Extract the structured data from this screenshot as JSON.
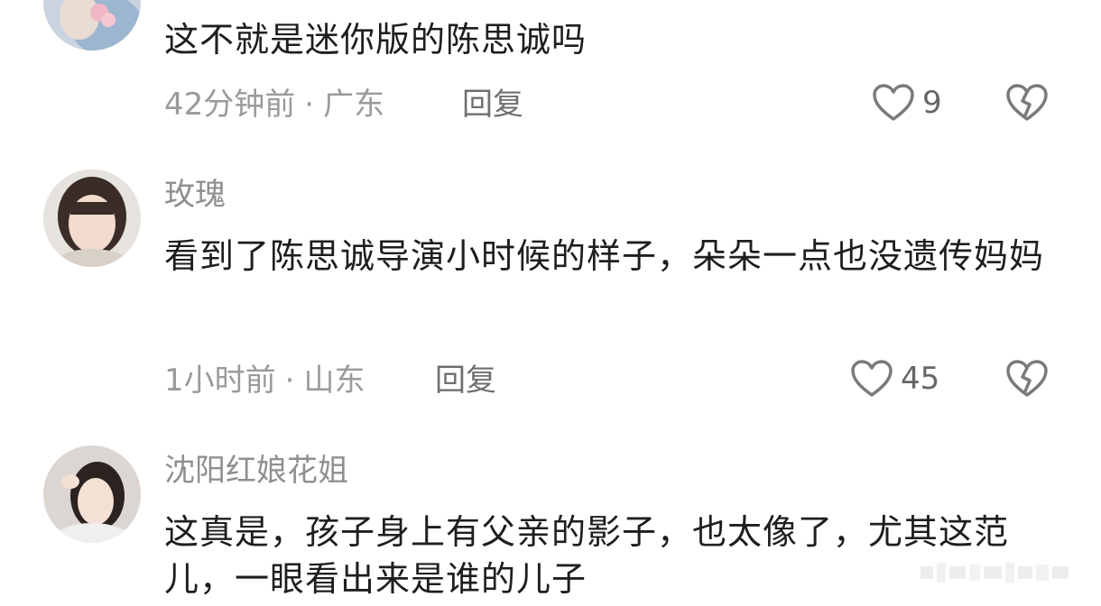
{
  "colors": {
    "username": "#8f8f8f",
    "text": "#1e1e1e",
    "meta": "#9a9a9a",
    "icon": "#7a7a7a"
  },
  "comments": [
    {
      "text": "这不就是迷你版的陈思诚吗",
      "time": "42分钟前",
      "location": "广东",
      "reply": "回复",
      "likes": "9"
    },
    {
      "username": "玫瑰",
      "text": "看到了陈思诚导演小时候的样子，朵朵一点也没遗传妈妈",
      "time": "1小时前",
      "location": "山东",
      "reply": "回复",
      "likes": "45"
    },
    {
      "username": "沈阳红娘花姐",
      "text": "这真是，孩子身上有父亲的影子，也太像了，尤其这范儿，一眼看出来是谁的儿子"
    }
  ],
  "icons": {
    "like": "heart-outline-icon",
    "dislike": "broken-heart-icon"
  }
}
